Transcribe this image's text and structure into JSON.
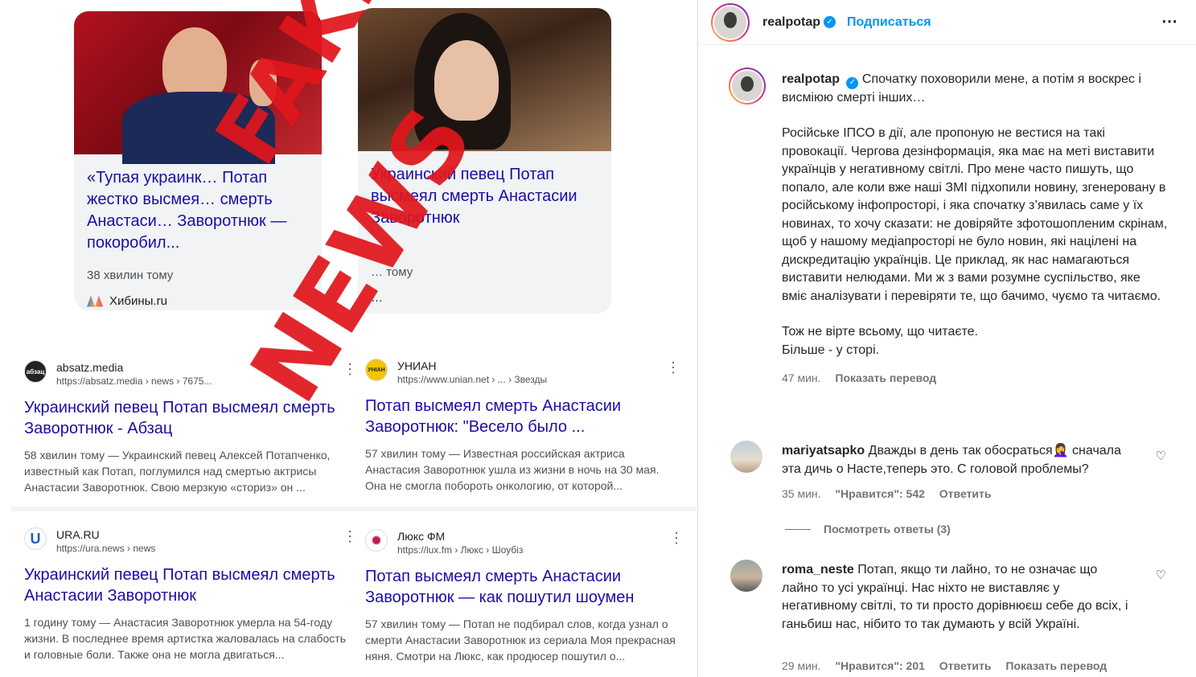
{
  "collage": {
    "cards": [
      {
        "headline": "«Тупая украинк… Потап жестко высмея… смерть Анастаси… Заворотнюк — покоробил...",
        "time": "38 хвилин тому",
        "source": "Хибины.ru"
      },
      {
        "headline": "Украинский певец Потап высмеял смерть Анастасии Заворотнюк",
        "time": "… тому",
        "source": "…"
      }
    ],
    "stamp": {
      "line1": "FAKE",
      "line2": "NEWS"
    },
    "results": [
      {
        "site": "absatz.media",
        "url": "https://absatz.media › news › 7675...",
        "fav": "абзац",
        "title": "Украинский певец Потап высмеял смерть Заворотнюк - Абзац",
        "snippet": "58 хвилин тому — Украинский певец Алексей Потапченко, известный как Потап, поглумился над смертью актрисы Анастасии Заворотнюк. Свою мерзкую «сториз» он ..."
      },
      {
        "site": "УНИАН",
        "url": "https://www.unian.net › ... › Звезды",
        "fav": "УНІАН",
        "title": "Потап высмеял смерть Анастасии Заворотнюк: \"Весело было ...",
        "snippet": "57 хвилин тому — Известная российская актриса Анастасия Заворотнюк ушла из жизни в ночь на 30 мая. Она не смогла побороть онкологию, от которой..."
      },
      {
        "site": "URA.RU",
        "url": "https://ura.news › news",
        "fav": "U",
        "title": "Украинский певец Потап высмеял смерть Анастасии Заворотнюк",
        "snippet": "1 годину тому — Анастасия Заворотнюк умерла на 54-году жизни. В последнее время артистка жаловалась на слабость и головные боли. Также она не могла двигаться..."
      },
      {
        "site": "Люкс ФМ",
        "url": "https://lux.fm › Люкс › Шоубіз",
        "fav": "✺",
        "title": "Потап высмеял смерть Анастасии Заворотнюк — как пошутил шоумен",
        "snippet": "57 хвилин тому — Потап не подбирал слов, когда узнал о смерти Анастасии Заворотнюк из сериала Моя прекрасная няня. Смотри на Люкс, как продюсер пошутил о..."
      }
    ]
  },
  "post": {
    "username": "realpotap",
    "follow_label": "Подписаться",
    "more_label": "⋮",
    "caption_first": "Спочатку поховорили мене, а потім я воскрес і висміюю смерті інших…",
    "caption_p2": "Російське ІПСО в дії, але пропоную не вестися на такі провокації. Чергова дезінформація, яка має на меті виставити українців у негативному світлі. Про мене часто пишуть, що попало, але коли вже наші ЗМІ підхопили новину, згенеровану в російському інфопросторі, і яка спочатку з’явилась саме у їх новинах, то хочу сказати: не довіряйте зфотошопленим скрінам, щоб у нашому медіапросторі не було новин, які націлені на дискредитацію українців. Це приклад, як нас намагаються виставити нелюдами. Ми ж з вами розумне суспільство, яке вміє аналізувати і перевіряти те, що бачимо, чуємо та читаємо.",
    "caption_p3a": "Тож не вірте всьому, що читаєте.",
    "caption_p3b": "Більше - у сторі.",
    "time": "47 мин.",
    "translate_label": "Показать перевод"
  },
  "comments": [
    {
      "user": "mariyatsapko",
      "text": "Дважды в день так обосраться🤦‍♀️ сначала эта дичь о Насте,теперь это. С головой проблемы?",
      "time": "35 мин.",
      "likes": "\"Нравится\": 542",
      "reply": "Ответить",
      "view_replies": "Посмотреть ответы (3)"
    },
    {
      "user": "roma_neste",
      "text": "Потап, якщо ти лайно, то не означає що лайно то усі українці. Нас ніхто не виставляє у негативному світлі, то ти просто дорівнюєш себе до всіх, і ганьбиш нас, нібито то так думають у всій Україні.",
      "time": "29 мин.",
      "likes": "\"Нравится\": 201",
      "reply": "Ответить",
      "translate": "Показать перевод"
    }
  ]
}
